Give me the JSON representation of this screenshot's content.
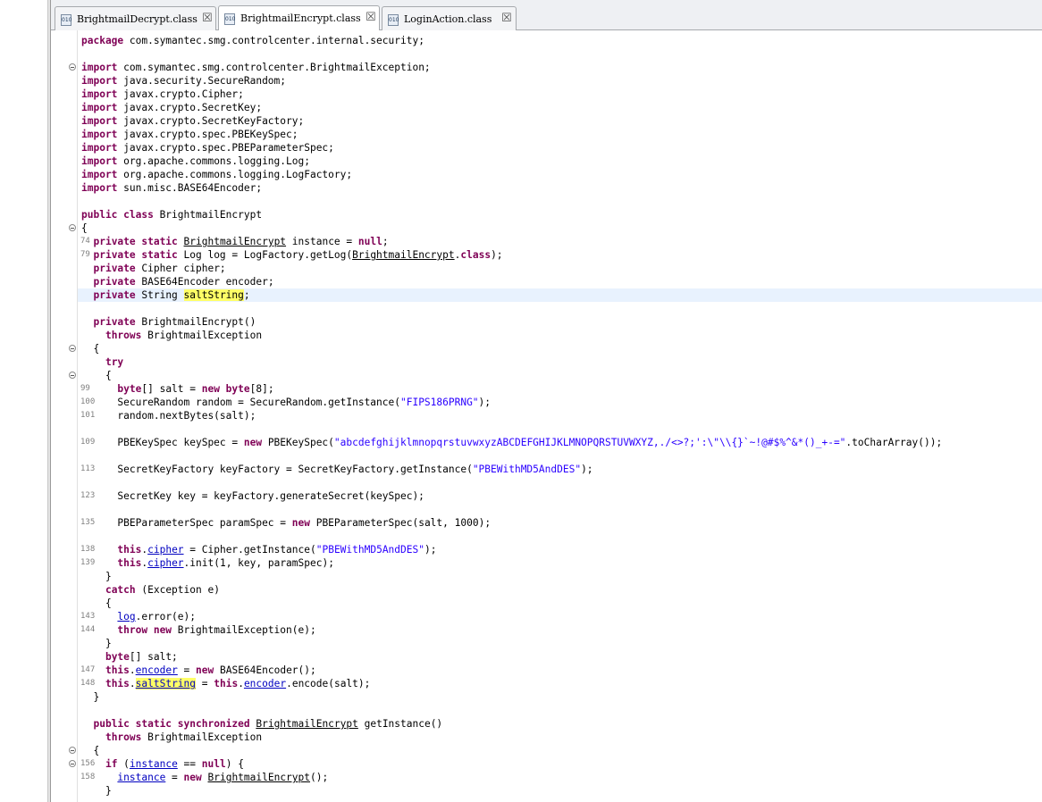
{
  "tabs": [
    {
      "label": "BrightmailDecrypt.class",
      "icon": "class-file-icon",
      "active": false
    },
    {
      "label": "BrightmailEncrypt.class",
      "icon": "class-file-icon",
      "active": true
    },
    {
      "label": "LoginAction.class",
      "icon": "class-file-icon",
      "active": false
    }
  ],
  "code": {
    "package_kw": "package",
    "package_name": " com.symantec.smg.controlcenter.internal.security;",
    "import_kw": "import",
    "imports": [
      " com.symantec.smg.controlcenter.BrightmailException;",
      " java.security.SecureRandom;",
      " javax.crypto.Cipher;",
      " javax.crypto.SecretKey;",
      " javax.crypto.SecretKeyFactory;",
      " javax.crypto.spec.PBEKeySpec;",
      " javax.crypto.spec.PBEParameterSpec;",
      " org.apache.commons.logging.Log;",
      " org.apache.commons.logging.LogFactory;",
      " sun.misc.BASE64Encoder;"
    ],
    "line_numbers": {
      "l74": "74",
      "l79": "79",
      "l99": "99",
      "l100": "100",
      "l101": "101",
      "l109": "109",
      "l113": "113",
      "l123": "123",
      "l135": "135",
      "l138": "138",
      "l139": "139",
      "l143": "143",
      "l144": "144",
      "l147": "147",
      "l148": "148",
      "l156": "156",
      "l158": "158"
    },
    "salt_string_literal": "\"abcdefghijklmnopqrstuvwxyzABCDEFGHIJKLMNOPQRSTUVWXYZ,./<>?;':\\\"\\\\{}`~!@#$%^&*()_+-=\"",
    "fips_literal": "\"FIPS186PRNG\"",
    "pbe_literal": "\"PBEWithMD5AndDES\"",
    "iterations": "1000"
  }
}
